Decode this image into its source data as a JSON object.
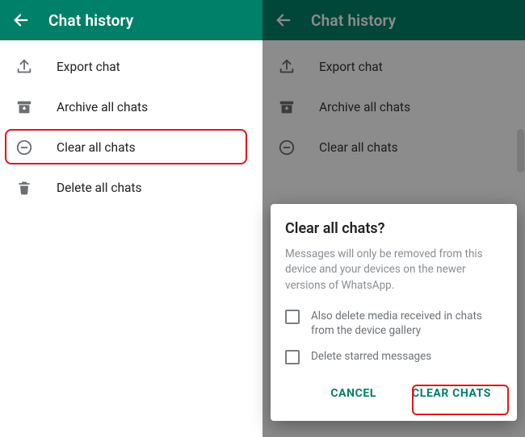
{
  "left": {
    "header": {
      "title": "Chat history"
    },
    "items": [
      {
        "id": "export",
        "label": "Export chat"
      },
      {
        "id": "archive",
        "label": "Archive all chats"
      },
      {
        "id": "clear",
        "label": "Clear all chats"
      },
      {
        "id": "delete",
        "label": "Delete all chats"
      }
    ]
  },
  "right": {
    "header": {
      "title": "Chat history"
    },
    "items": [
      {
        "id": "export",
        "label": "Export chat"
      },
      {
        "id": "archive",
        "label": "Archive all chats"
      },
      {
        "id": "clear",
        "label": "Clear all chats"
      }
    ]
  },
  "dialog": {
    "title": "Clear all chats?",
    "message": "Messages will only be removed from this device and your devices on the newer versions of WhatsApp.",
    "option_media": "Also delete media received in chats from the device gallery",
    "option_starred": "Delete starred messages",
    "cancel": "CANCEL",
    "confirm": "CLEAR CHATS"
  },
  "colors": {
    "accent": "#008069",
    "highlight": "#e11717"
  }
}
